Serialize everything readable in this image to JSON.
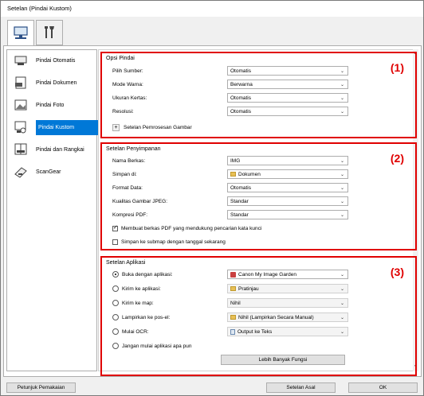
{
  "window": {
    "title": "Setelan (Pindai Kustom)"
  },
  "top_tabs": [
    {
      "name": "scan-tab",
      "icon": "computer-scan-icon"
    },
    {
      "name": "general-settings-tab",
      "icon": "tools-icon"
    }
  ],
  "nav": {
    "items": [
      {
        "label": "Pindai Otomatis",
        "icon": "auto-scan-icon"
      },
      {
        "label": "Pindai Dokumen",
        "icon": "document-scan-icon"
      },
      {
        "label": "Pindai Foto",
        "icon": "photo-scan-icon"
      },
      {
        "label": "Pindai Kustom",
        "icon": "custom-scan-icon",
        "selected": true
      },
      {
        "label": "Pindai dan Rangkai",
        "icon": "scan-stitch-icon"
      },
      {
        "label": "ScanGear",
        "icon": "scangear-icon"
      }
    ]
  },
  "scan_options": {
    "title": "Opsi Pindai",
    "marker": "(1)",
    "rows": [
      {
        "label": "Pilih Sumber:",
        "value": "Otomatis"
      },
      {
        "label": "Mode Warna:",
        "value": "Berwarna"
      },
      {
        "label": "Ukuran Kertas:",
        "value": "Otomatis"
      },
      {
        "label": "Resolusi:",
        "value": "Otomatis"
      }
    ],
    "image_processing_label": "Setelan Pemrosesan Gambar"
  },
  "save_settings": {
    "title": "Setelan Penyimpanan",
    "marker": "(2)",
    "rows": [
      {
        "label": "Nama Berkas:",
        "value": "IMG"
      },
      {
        "label": "Simpan di:",
        "value": "Dokumen"
      },
      {
        "label": "Format Data:",
        "value": "Otomatis"
      },
      {
        "label": "Kualitas Gambar JPEG:",
        "value": "Standar"
      },
      {
        "label": "Kompresi PDF:",
        "value": "Standar"
      }
    ],
    "checkboxes": [
      {
        "label": "Membuat berkas PDF yang mendukung pencarian kata kunci",
        "checked": true
      },
      {
        "label": "Simpan ke submap dengan tanggal sekarang",
        "checked": false
      }
    ]
  },
  "app_settings": {
    "title": "Setelan Aplikasi",
    "marker": "(3)",
    "rows": [
      {
        "label": "Buka dengan aplikasi:",
        "value": "Canon My Image Garden",
        "checked": true,
        "disabled": false
      },
      {
        "label": "Kirim ke aplikasi:",
        "value": "Pratinjau",
        "checked": false,
        "disabled": true
      },
      {
        "label": "Kirim ke map:",
        "value": "Nihil",
        "checked": false,
        "disabled": true
      },
      {
        "label": "Lampirkan ke pos-el:",
        "value": "Nihil (Lampirkan Secara Manual)",
        "checked": false,
        "disabled": true
      },
      {
        "label": "Mulai OCR:",
        "value": "Output ke Teks",
        "checked": false,
        "disabled": true
      },
      {
        "label": "Jangan mulai aplikasi apa pun",
        "checked": false
      }
    ],
    "more_functions_label": "Lebih Banyak Fungsi"
  },
  "footer": {
    "instructions_label": "Petunjuk Pemakaian",
    "defaults_label": "Setelan Asal",
    "ok_label": "OK"
  }
}
